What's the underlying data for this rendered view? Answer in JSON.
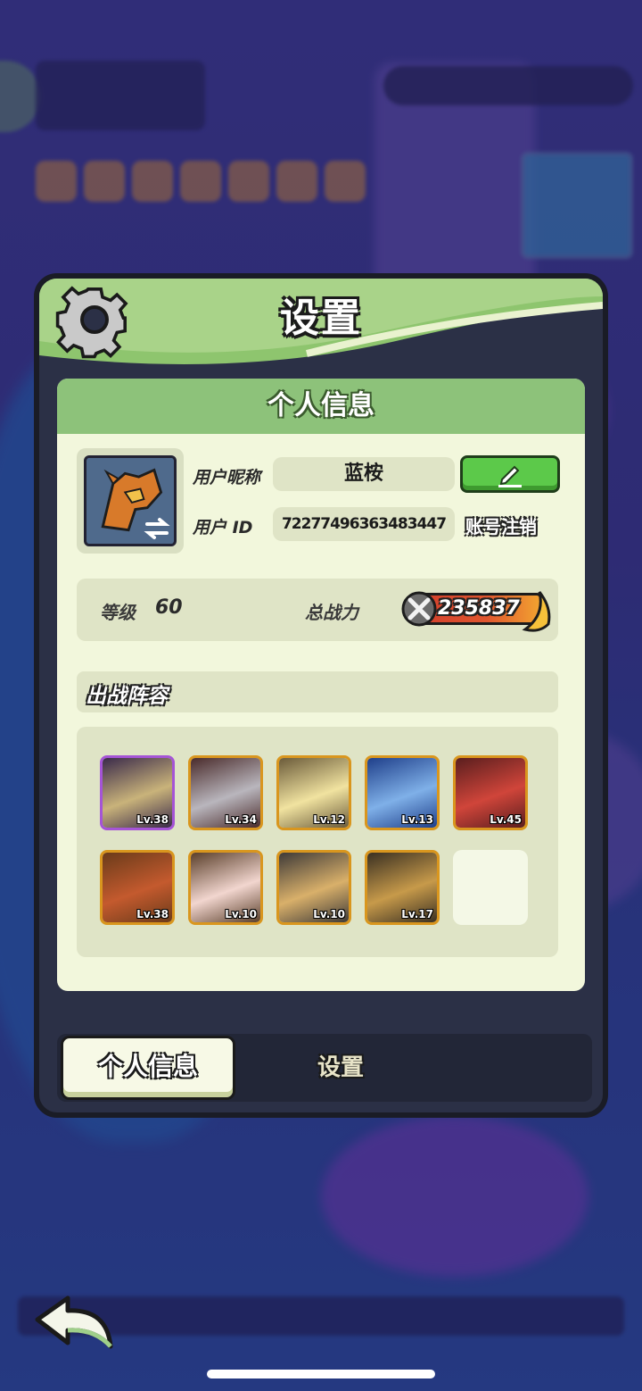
{
  "panel": {
    "title": "设置"
  },
  "profile": {
    "section_title": "个人信息",
    "nickname_label": "用户昵称",
    "nickname": "蓝桉",
    "userid_label": "用户 ID",
    "userid": "72277496363483447",
    "delete_account_label": "账号注销"
  },
  "stats": {
    "level_label": "等级",
    "level": "60",
    "power_label": "总战力",
    "power": "235837"
  },
  "lineup": {
    "title": "出战阵容",
    "heroes": [
      {
        "level": "Lv.38",
        "rarity": "purple",
        "colors": [
          "#3a2a4a",
          "#c9b37a"
        ]
      },
      {
        "level": "Lv.34",
        "rarity": "gold",
        "colors": [
          "#4a2b2b",
          "#b9b6bd"
        ]
      },
      {
        "level": "Lv.12",
        "rarity": "gold",
        "colors": [
          "#6b5b3a",
          "#f1e3a0"
        ]
      },
      {
        "level": "Lv.13",
        "rarity": "gold",
        "colors": [
          "#1f3f8a",
          "#7fb0e8"
        ]
      },
      {
        "level": "Lv.45",
        "rarity": "gold",
        "colors": [
          "#5a1e1e",
          "#d0453a"
        ]
      },
      {
        "level": "Lv.38",
        "rarity": "gold",
        "colors": [
          "#6a3b1a",
          "#c45a2e"
        ]
      },
      {
        "level": "Lv.10",
        "rarity": "gold",
        "colors": [
          "#5a3f2a",
          "#f2d6cf"
        ]
      },
      {
        "level": "Lv.10",
        "rarity": "gold",
        "colors": [
          "#3e3a38",
          "#d9b06a"
        ]
      },
      {
        "level": "Lv.17",
        "rarity": "gold",
        "colors": [
          "#3a3022",
          "#c79a4a"
        ]
      }
    ]
  },
  "tabs": {
    "active": "个人信息",
    "inactive": "设置"
  },
  "colors": {
    "header_green": "#8ec56e",
    "card_bg": "#f2f7dc",
    "edit_green": "#5cc94a",
    "power_red": "#cf3a2b"
  }
}
